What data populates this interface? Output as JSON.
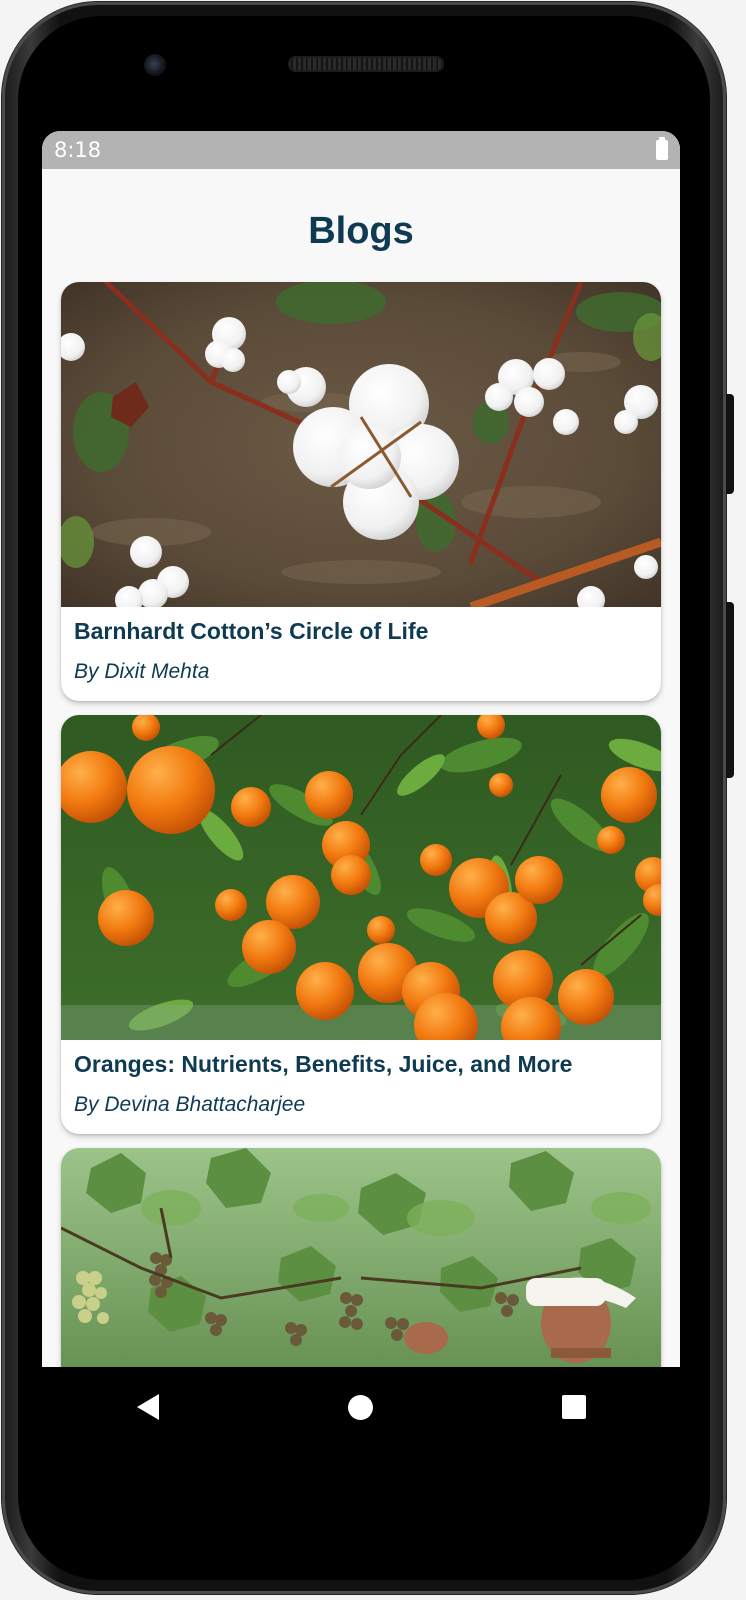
{
  "status_bar": {
    "time": "8:18",
    "battery_icon": "battery-full-icon"
  },
  "page": {
    "title": "Blogs"
  },
  "blogs": [
    {
      "title": "Barnhardt Cotton’s Circle of Life",
      "author": "By Dixit Mehta",
      "image": "cotton-plant-photo"
    },
    {
      "title": "Oranges: Nutrients, Benefits, Juice, and More",
      "author": "By Devina Bhattacharjee",
      "image": "orange-tree-photo"
    },
    {
      "title": "",
      "author": "",
      "image": "grape-vineyard-photo"
    }
  ],
  "nav": {
    "back_icon": "back-icon",
    "home_icon": "home-icon",
    "recents_icon": "recents-icon"
  },
  "colors": {
    "title": "#0e3a52",
    "status_bar": "#b3b3b3",
    "screen_bg": "#f8f8f8"
  }
}
